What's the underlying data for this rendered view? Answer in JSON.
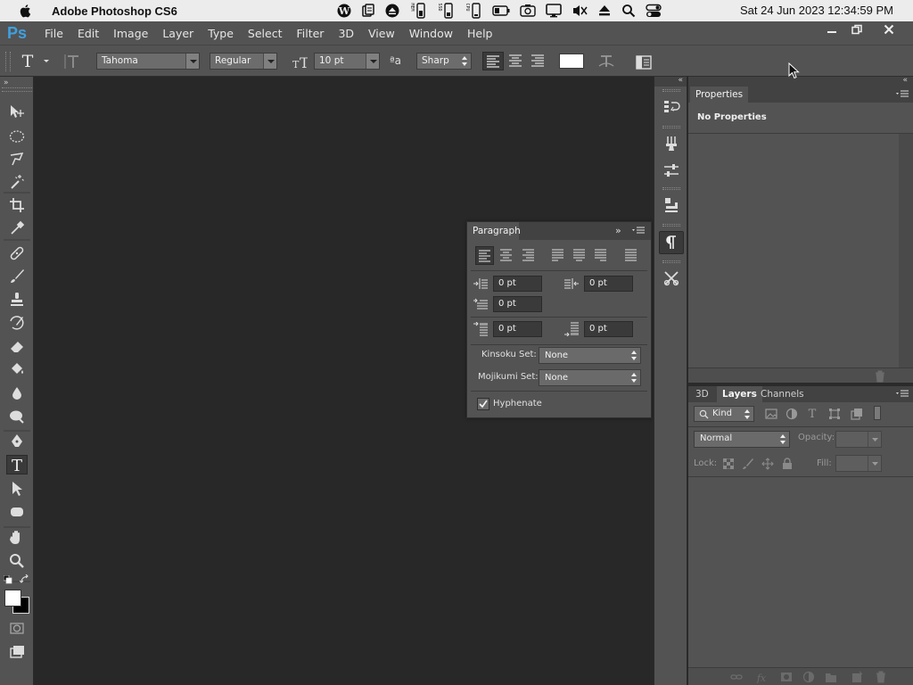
{
  "mac": {
    "app_name": "Adobe Photoshop CS6",
    "status_icons": [
      "wordpress-icon",
      "clipboard-icon",
      "eject-circle-icon",
      "memory-monitor-icon",
      "ssd-monitor-icon",
      "cpu-monitor-icon",
      "battery-icon",
      "camera-icon",
      "display-icon",
      "mute-icon",
      "eject-icon",
      "search-icon",
      "control-center-icon"
    ],
    "status_labels": {
      "mem": "MEM",
      "ssd": "SSD",
      "cpu": "CPU"
    },
    "clock": "Sat 24 Jun 2023  12:34:59 PM"
  },
  "menubar": {
    "logo": "Ps",
    "items": [
      "File",
      "Edit",
      "Image",
      "Layer",
      "Type",
      "Select",
      "Filter",
      "3D",
      "View",
      "Window",
      "Help"
    ]
  },
  "options": {
    "font_family": "Tahoma",
    "font_style": "Regular",
    "font_size": "10 pt",
    "aa_label": "ªa",
    "antialias": "Sharp",
    "text_color": "#ffffff"
  },
  "properties": {
    "tab": "Properties",
    "content": "No Properties"
  },
  "layers": {
    "tabs": [
      "3D",
      "Layers",
      "Channels"
    ],
    "active_tab": "Layers",
    "filter_kind": "Kind",
    "blend_mode": "Normal",
    "opacity_label": "Opacity:",
    "lock_label": "Lock:",
    "fill_label": "Fill:"
  },
  "paragraph": {
    "title": "Paragraph",
    "indent_left": "0 pt",
    "indent_right": "0 pt",
    "indent_first": "0 pt",
    "space_before": "0 pt",
    "space_after": "0 pt",
    "kinsoku_label": "Kinsoku Set:",
    "kinsoku_value": "None",
    "mojikumi_label": "Mojikumi Set:",
    "mojikumi_value": "None",
    "hyphenate_label": "Hyphenate",
    "hyphenate_checked": true
  },
  "colors": {
    "foreground": "#ffffff",
    "background": "#000000",
    "ps_blue": "#3fa0e0"
  }
}
